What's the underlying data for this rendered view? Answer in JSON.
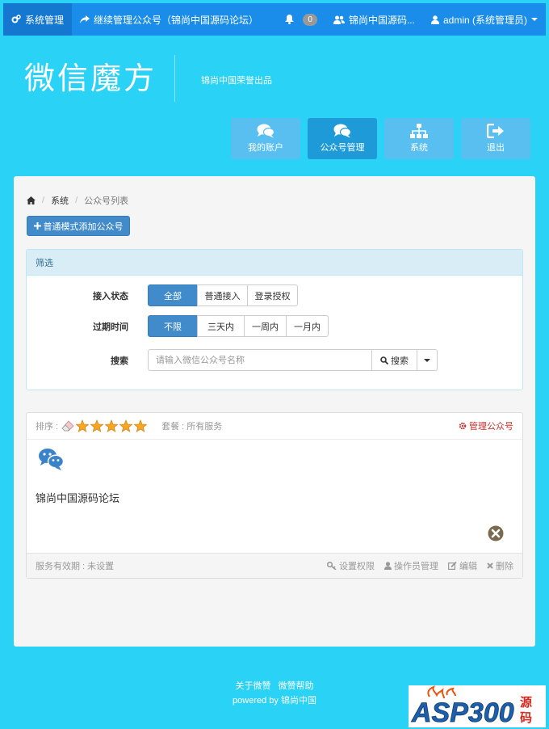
{
  "topbar": {
    "system_manage": "系统管理",
    "continue_manage": "继续管理公众号（锦尚中国源码论坛）",
    "notifications_count": "0",
    "account_short": "锦尚中国源码...",
    "user": "admin (系统管理员)"
  },
  "brand": {
    "logo_text": "微信魔方",
    "subtitle": "锦尚中国荣誉出品"
  },
  "tiles": [
    {
      "label": "我的账户",
      "icon": "comments-icon"
    },
    {
      "label": "公众号管理",
      "icon": "comments-icon"
    },
    {
      "label": "系统",
      "icon": "sitemap-icon"
    },
    {
      "label": "退出",
      "icon": "sign-out-icon"
    }
  ],
  "breadcrumb": {
    "home_icon": "home-icon",
    "items": [
      "系统",
      "公众号列表"
    ]
  },
  "add_button": "普通模式添加公众号",
  "filter": {
    "title": "筛选",
    "access_label": "接入状态",
    "access_options": [
      "全部",
      "普通接入",
      "登录授权"
    ],
    "access_selected": "全部",
    "expire_label": "过期时间",
    "expire_options": [
      "不限",
      "三天内",
      "一周内",
      "一月内"
    ],
    "expire_selected": "不限",
    "search_label": "搜索",
    "search_placeholder": "请输入微信公众号名称",
    "search_value": "",
    "search_button": "搜索"
  },
  "account": {
    "sort_label": "排序 :",
    "rating": 5,
    "meal_label": "套餐 : 所有服务",
    "manage_link": "管理公众号",
    "name": "锦尚中国源码论坛",
    "validity_label": "服务有效期 : 未设置",
    "actions": [
      "设置权限",
      "操作员管理",
      "编辑",
      "删除"
    ]
  },
  "footer": {
    "about": "关于微赞",
    "help": "微赞帮助",
    "powered": "powered by 锦尚中国"
  },
  "watermark": "ASP300源码",
  "colors": {
    "page_bg": "#2ad2f5",
    "navbar": "#1a8dea",
    "primary": "#428bca",
    "danger": "#c9302c",
    "star": "#f5a623"
  }
}
